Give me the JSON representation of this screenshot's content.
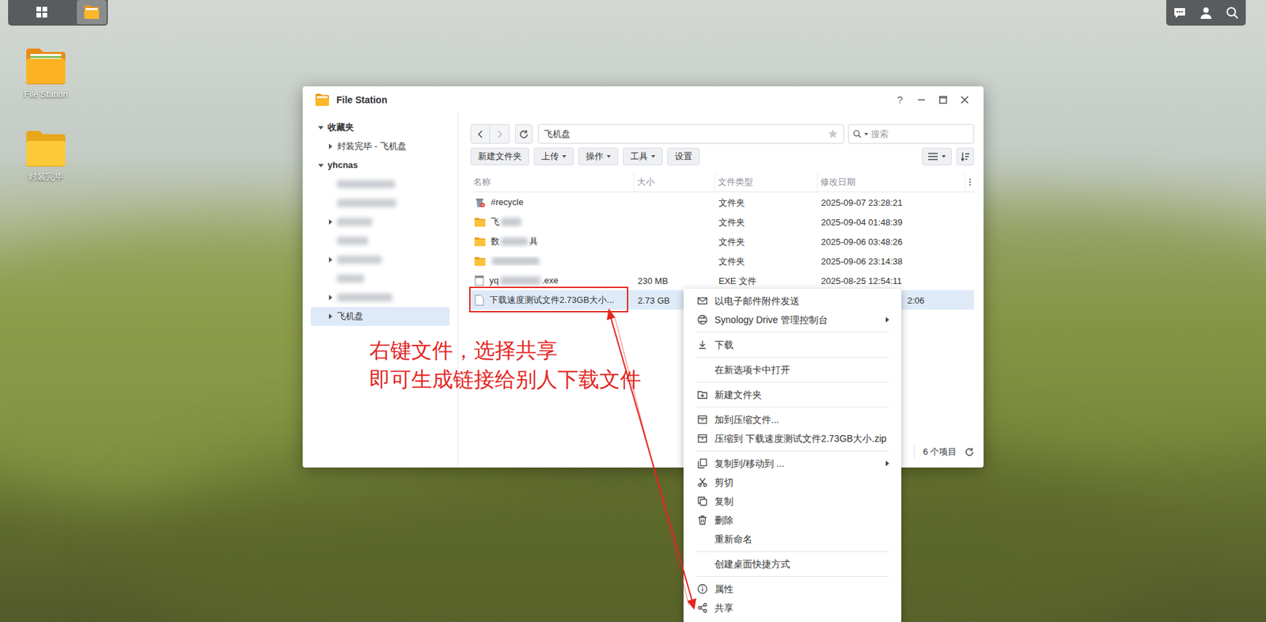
{
  "taskbar": {
    "buttons": [
      {
        "selected": false
      },
      {
        "selected": true
      }
    ]
  },
  "desktop_icons": [
    {
      "label": "File Station"
    },
    {
      "label": "封装完毕"
    }
  ],
  "window": {
    "title": "File Station",
    "help": "?"
  },
  "sidebar": {
    "items": [
      {
        "kind": "group",
        "label": "收藏夹",
        "expanded": true,
        "selected": false
      },
      {
        "kind": "child",
        "label": "封装完毕 - 飞机盘",
        "expanded": false,
        "selected": false
      },
      {
        "kind": "group",
        "label": "yhcnas",
        "expanded": true,
        "selected": false
      },
      {
        "kind": "blurred",
        "selected": false
      },
      {
        "kind": "blurred",
        "selected": false
      },
      {
        "kind": "blurred",
        "expanded": false,
        "selected": false
      },
      {
        "kind": "blurred",
        "selected": false
      },
      {
        "kind": "blurred",
        "expanded": false,
        "selected": false
      },
      {
        "kind": "blurred",
        "selected": false
      },
      {
        "kind": "blurred",
        "expanded": false,
        "selected": false
      },
      {
        "kind": "child",
        "label": "飞机盘",
        "expanded": false,
        "selected": true
      }
    ]
  },
  "toolbar": {
    "back_disabled": false,
    "forward_disabled": true,
    "path": "飞机盘",
    "favorite": false,
    "search_placeholder": "搜索",
    "buttons": [
      {
        "label": "新建文件夹",
        "dropdown": false
      },
      {
        "label": "上传",
        "dropdown": true
      },
      {
        "label": "操作",
        "dropdown": true
      },
      {
        "label": "工具",
        "dropdown": true
      },
      {
        "label": "设置",
        "dropdown": false
      }
    ]
  },
  "table": {
    "columns": [
      "名称",
      "大小",
      "文件类型",
      "修改日期"
    ],
    "rows": [
      {
        "kind": "recycle",
        "name": "#recycle",
        "blurred": false,
        "type": "文件夹",
        "date": "2025-09-07 23:28:21",
        "selected": false
      },
      {
        "kind": "folder",
        "name": "飞",
        "blurred": true,
        "type": "文件夹",
        "date": "2025-09-04 01:48:39",
        "selected": false
      },
      {
        "kind": "folder",
        "name": "数",
        "blurred": true,
        "name_tail": "具",
        "type": "文件夹",
        "date": "2025-09-06 03:48:26",
        "selected": false
      },
      {
        "kind": "folder",
        "name": "",
        "blurred": true,
        "type": "文件夹",
        "date": "2025-09-06 23:14:38",
        "selected": false
      },
      {
        "kind": "exe",
        "name": "yq",
        "blurred": true,
        "name_tail": ".exe",
        "size": "230 MB",
        "type": "EXE 文件",
        "date": "2025-08-25 12:54:11",
        "selected": false
      },
      {
        "kind": "file",
        "name": "下载速度测试文件2.73GB大小...",
        "blurred": false,
        "size": "2.73 GB",
        "date": "2:06",
        "selected": true
      }
    ]
  },
  "status_bar": {
    "count": "6 个项目"
  },
  "context_menu": {
    "groups": [
      [
        {
          "label": "以电子邮件附件发送",
          "submenu": false
        },
        {
          "label": "Synology Drive 管理控制台",
          "submenu": true
        }
      ],
      [
        {
          "label": "下载",
          "submenu": false
        }
      ],
      [
        {
          "label": "在新选项卡中打开",
          "submenu": false
        }
      ],
      [
        {
          "label": "新建文件夹",
          "submenu": false
        }
      ],
      [
        {
          "label": "加到压缩文件...",
          "submenu": false
        },
        {
          "label": "压缩到 下载速度测试文件2.73GB大小.zip",
          "submenu": false
        }
      ],
      [
        {
          "label": "复制到/移动到 ...",
          "submenu": true
        },
        {
          "label": "剪切",
          "submenu": false
        },
        {
          "label": "复制",
          "submenu": false
        },
        {
          "label": "删除",
          "submenu": false
        },
        {
          "label": "重新命名",
          "submenu": false
        }
      ],
      [
        {
          "label": "创建桌面快捷方式",
          "submenu": false
        }
      ],
      [
        {
          "label": "属性",
          "submenu": false
        },
        {
          "label": "共享",
          "submenu": true
        }
      ]
    ]
  },
  "annotation": {
    "lines": [
      "右键文件，选择共享",
      "即可生成链接给别人下载文件"
    ]
  }
}
